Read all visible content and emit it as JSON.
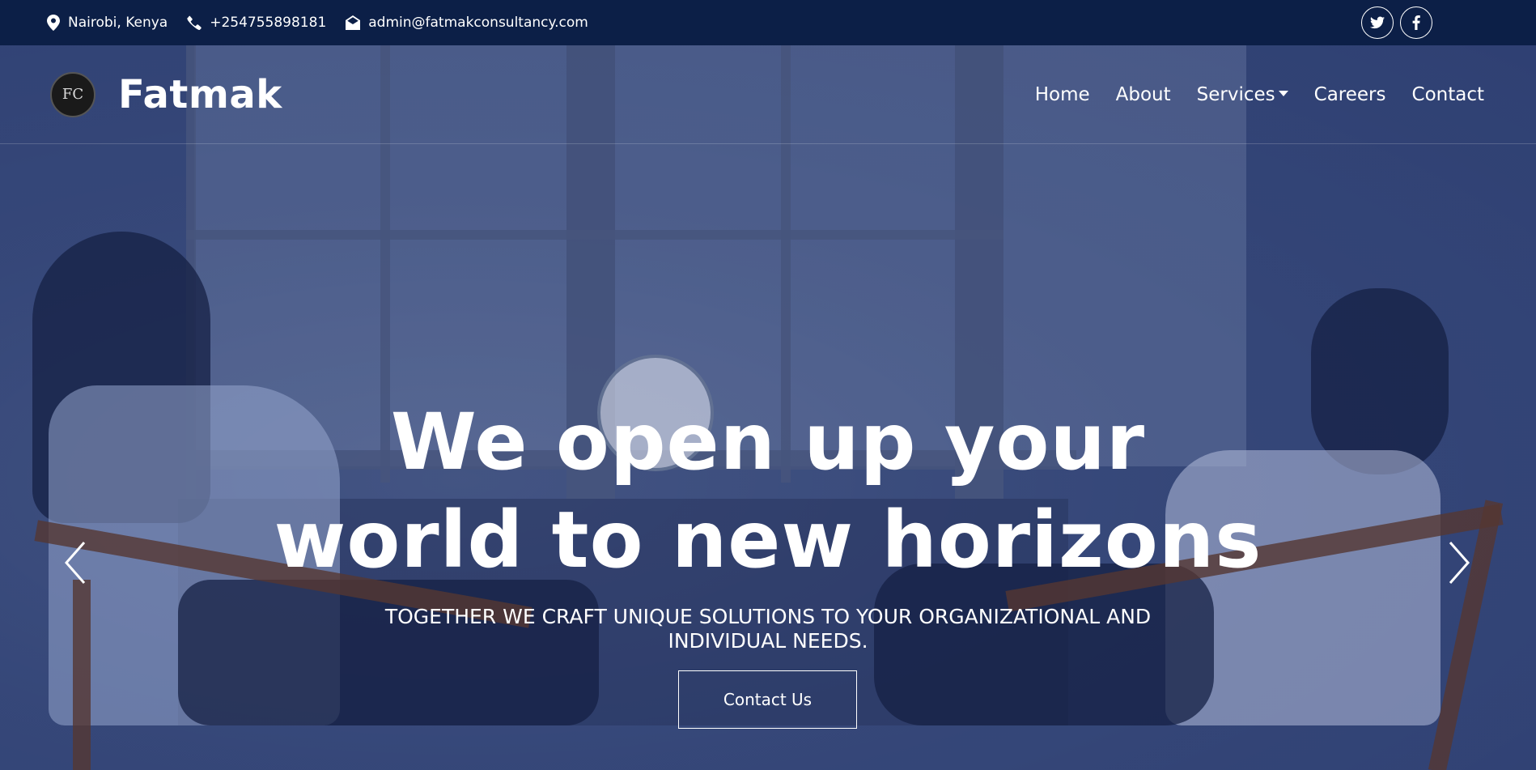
{
  "topbar": {
    "location": "Nairobi, Kenya",
    "phone": "+254755898181",
    "email": "admin@fatmakconsultancy.com",
    "social": [
      "twitter-icon",
      "facebook-icon"
    ]
  },
  "navbar": {
    "logo_text": "FC",
    "brand": "Fatmak",
    "links": [
      {
        "label": "Home"
      },
      {
        "label": "About"
      },
      {
        "label": "Services",
        "dropdown": true
      },
      {
        "label": "Careers"
      },
      {
        "label": "Contact"
      }
    ]
  },
  "hero": {
    "headline_line1": "We open up your",
    "headline_line2": "world to new horizons",
    "subline": "TOGETHER WE CRAFT UNIQUE SOLUTIONS TO YOUR ORGANIZATIONAL AND INDIVIDUAL NEEDS.",
    "cta_label": "Contact Us"
  },
  "colors": {
    "topbar_bg": "#0c1f47",
    "overlay": "#2d3e70",
    "text": "#ffffff"
  }
}
